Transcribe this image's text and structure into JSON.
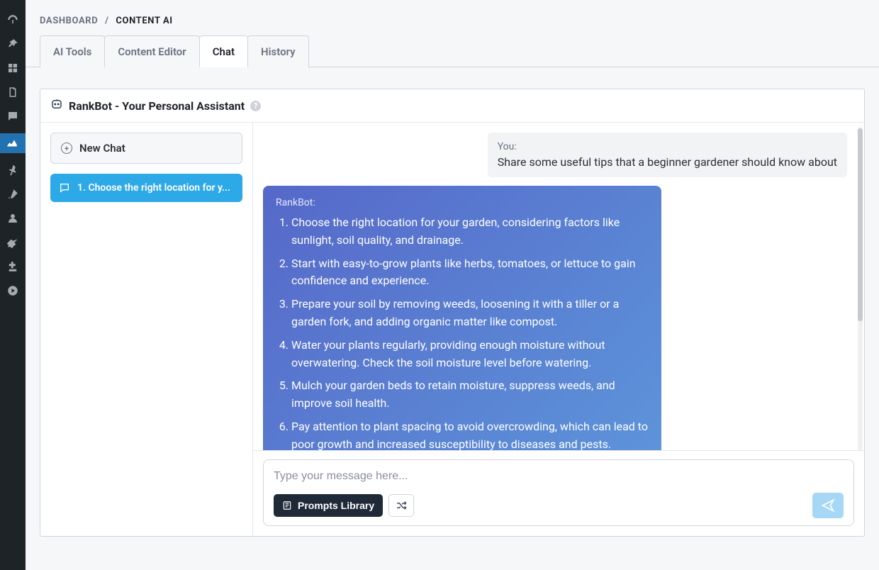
{
  "breadcrumbs": {
    "root": "DASHBOARD",
    "current": "CONTENT AI"
  },
  "tabs": [
    {
      "label": "AI Tools",
      "active": false
    },
    {
      "label": "Content Editor",
      "active": false
    },
    {
      "label": "Chat",
      "active": true
    },
    {
      "label": "History",
      "active": false
    }
  ],
  "panel": {
    "title": "RankBot - Your Personal Assistant",
    "help_symbol": "?"
  },
  "chat_list": {
    "new_chat_label": "New Chat",
    "items": [
      {
        "label": "1. Choose the right location for y..."
      }
    ]
  },
  "conversation": {
    "user": {
      "from": "You:",
      "text": "Share some useful tips that a beginner gardener should know about"
    },
    "bot": {
      "from": "RankBot:",
      "tips": [
        "Choose the right location for your garden, considering factors like sunlight, soil quality, and drainage.",
        "Start with easy-to-grow plants like herbs, tomatoes, or lettuce to gain confidence and experience.",
        "Prepare your soil by removing weeds, loosening it with a tiller or a garden fork, and adding organic matter like compost.",
        "Water your plants regularly, providing enough moisture without overwatering. Check the soil moisture level before watering.",
        "Mulch your garden beds to retain moisture, suppress weeds, and improve soil health.",
        "Pay attention to plant spacing to avoid overcrowding, which can lead to poor growth and increased susceptibility to diseases and pests."
      ]
    }
  },
  "composer": {
    "placeholder": "Type your message here...",
    "prompts_library_label": "Prompts Library"
  }
}
